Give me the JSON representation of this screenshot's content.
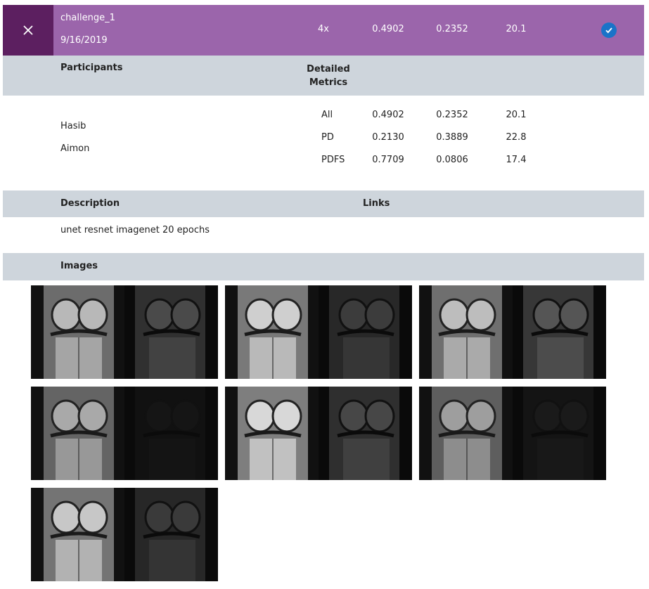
{
  "header": {
    "name": "challenge_1",
    "date": "9/16/2019",
    "scale": "4x",
    "metric1": "0.4902",
    "metric2": "0.2352",
    "metric3": "20.1",
    "close_icon": "close-icon",
    "check_icon": "check-circle-icon",
    "accent": "#9b65ab",
    "accent_dark": "#5c1f60"
  },
  "participants_section": {
    "title": "Participants",
    "detailed_title": "Detailed",
    "detailed_title2": "Metrics",
    "participants": [
      "Hasib",
      "Aimon"
    ],
    "metrics": [
      {
        "label": "All",
        "v1": "0.4902",
        "v2": "0.2352",
        "v3": "20.1"
      },
      {
        "label": "PD",
        "v1": "0.2130",
        "v2": "0.3889",
        "v3": "22.8"
      },
      {
        "label": "PDFS",
        "v1": "0.7709",
        "v2": "0.0806",
        "v3": "17.4"
      }
    ]
  },
  "description_section": {
    "title": "Description",
    "links_title": "Links",
    "text": "unet resnet imagenet 20 epochs"
  },
  "images_section": {
    "title": "Images",
    "count": 7
  }
}
